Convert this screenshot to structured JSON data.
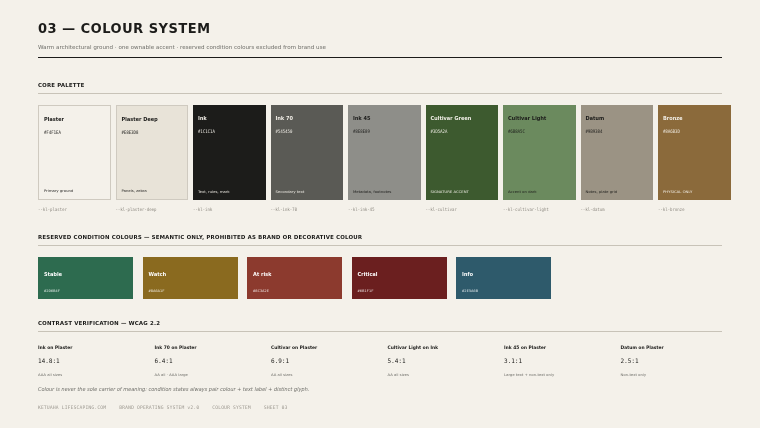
{
  "header": {
    "title": "03 — COLOUR SYSTEM",
    "subtitle": "Warm architectural ground · one ownable accent · reserved condition colours excluded from brand use"
  },
  "core": {
    "heading": "CORE PALETTE",
    "swatches": [
      {
        "name": "Plaster",
        "hex": "#F4F1EA",
        "use": "Primary ground",
        "token": "--kl-plaster",
        "bg": "#F4F1EA",
        "fg": "#1C1C1A",
        "bordered": true
      },
      {
        "name": "Plaster Deep",
        "hex": "#E8E3D8",
        "use": "Panels, zebra",
        "token": "--kl-plaster-deep",
        "bg": "#E8E3D8",
        "fg": "#1C1C1A",
        "bordered": true
      },
      {
        "name": "Ink",
        "hex": "#1C1C1A",
        "use": "Text, rules, mark",
        "token": "--kl-ink",
        "bg": "#1C1C1A",
        "fg": "#F4F1EA",
        "bordered": false
      },
      {
        "name": "Ink 70",
        "hex": "#545450",
        "use": "Secondary text",
        "token": "--kl-ink-70",
        "bg": "#5A5A55",
        "fg": "#F4F1EA",
        "bordered": false
      },
      {
        "name": "Ink 45",
        "hex": "#8E8E89",
        "use": "Metadata, footnotes",
        "token": "--kl-ink-45",
        "bg": "#8E8E89",
        "fg": "#1C1C1A",
        "bordered": false
      },
      {
        "name": "Cultivar Green",
        "hex": "#3D5A2A",
        "use": "SIGNATURE ACCENT",
        "token": "--kl-cultivar",
        "bg": "#3D5A2F",
        "fg": "#F4F1EA",
        "bordered": false
      },
      {
        "name": "Cultivar Light",
        "hex": "#6B8A5C",
        "use": "Accent on dark",
        "token": "--kl-cultivar-light",
        "bg": "#6B8A5E",
        "fg": "#1C1C1A",
        "bordered": false
      },
      {
        "name": "Datum",
        "hex": "#9B9384",
        "use": "Notes, plate grid",
        "token": "--kl-datum",
        "bg": "#9B9384",
        "fg": "#1C1C1A",
        "bordered": false
      },
      {
        "name": "Bronze",
        "hex": "#8A6B3D",
        "use": "PHYSICAL ONLY",
        "token": "--kl-bronze",
        "bg": "#8B6A3B",
        "fg": "#F4F1EA",
        "bordered": false
      }
    ]
  },
  "reserved": {
    "heading": "RESERVED CONDITION COLOURS — SEMANTIC ONLY, PROHIBITED AS BRAND OR DECORATIVE COLOUR",
    "items": [
      {
        "name": "Stable",
        "hex": "#2D6B4F",
        "bg": "#2D6B4F"
      },
      {
        "name": "Watch",
        "hex": "#8A6A1F",
        "bg": "#8A6A1F"
      },
      {
        "name": "At risk",
        "hex": "#8C3A2E",
        "bg": "#8C3A2E"
      },
      {
        "name": "Critical",
        "hex": "#6B1F1F",
        "bg": "#6B1F1F"
      },
      {
        "name": "Info",
        "hex": "#2E5A6B",
        "bg": "#2E5A6B"
      }
    ]
  },
  "contrast": {
    "heading": "CONTRAST VERIFICATION — WCAG 2.2",
    "items": [
      {
        "label": "Ink on Plaster",
        "ratio": "14.8:1",
        "note": "AAA all sizes"
      },
      {
        "label": "Ink 70 on Plaster",
        "ratio": "6.4:1",
        "note": "AA all · AAA large"
      },
      {
        "label": "Cultivar on Plaster",
        "ratio": "6.9:1",
        "note": "AA all sizes"
      },
      {
        "label": "Cultivar Light on Ink",
        "ratio": "5.4:1",
        "note": "AA all sizes"
      },
      {
        "label": "Ink 45 on Plaster",
        "ratio": "3.1:1",
        "note": "Large text + non-text only"
      },
      {
        "label": "Datum on Plaster",
        "ratio": "2.5:1",
        "note": "Non-text only"
      }
    ]
  },
  "note": "Colour is never the sole carrier of meaning: condition states always pair colour + text label + distinct glyph.",
  "footer": [
    "KETUAHA LIFESCAPING.COM",
    "BRAND OPERATING SYSTEM v2.0",
    "COLOUR SYSTEM",
    "SHEET 03"
  ]
}
